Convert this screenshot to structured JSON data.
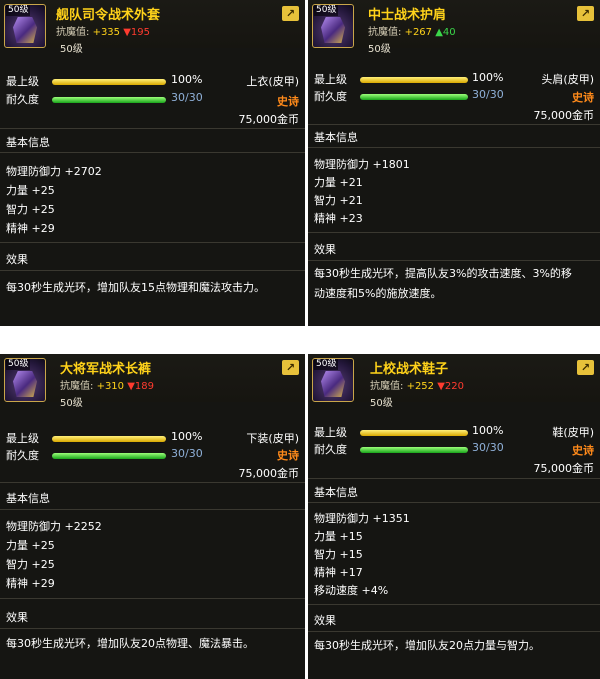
{
  "labels": {
    "max_level": "最上级",
    "durability": "耐久度",
    "resist": "抗魔值:",
    "basic_info": "基本信息",
    "effect": "效果"
  },
  "colors": {
    "rarity": "#ff8a1a",
    "name": "#ffd21a",
    "negative": "#ff3b2f",
    "positive": "#3bd64a"
  },
  "cards": [
    {
      "level_badge": "50级",
      "name": "舰队司令战术外套",
      "resist_plus": "+335",
      "resist_delta": "▼195",
      "resist_delta_type": "down",
      "level": "50级",
      "max_level_pct": "100%",
      "max_level_fraction": 1.0,
      "durability": "30/30",
      "durability_fraction": 1.0,
      "slot": "上衣(皮甲)",
      "rarity": "史诗",
      "price": "75,000金币",
      "icon": "coat-armor-icon",
      "stats": [
        "物理防御力 +2702",
        "力量 +25",
        "智力 +25",
        "精神 +29"
      ],
      "effect_lines": [
        "每30秒生成光环，增加队友15点物理和魔法攻击力。"
      ]
    },
    {
      "level_badge": "50级",
      "name": "中士战术护肩",
      "resist_plus": "+267",
      "resist_delta": "▲40",
      "resist_delta_type": "up",
      "level": "50级",
      "max_level_pct": "100%",
      "max_level_fraction": 1.0,
      "durability": "30/30",
      "durability_fraction": 1.0,
      "slot": "头肩(皮甲)",
      "rarity": "史诗",
      "price": "75,000金币",
      "icon": "shoulder-armor-icon",
      "stats": [
        "物理防御力 +1801",
        "力量 +21",
        "智力 +21",
        "精神 +23"
      ],
      "effect_lines": [
        "每30秒生成光环，提高队友3%的攻击速度、3%的移",
        "动速度和5%的施放速度。"
      ]
    },
    {
      "level_badge": "50级",
      "name": "大将军战术长裤",
      "resist_plus": "+310",
      "resist_delta": "▼189",
      "resist_delta_type": "down",
      "level": "50级",
      "max_level_pct": "100%",
      "max_level_fraction": 1.0,
      "durability": "30/30",
      "durability_fraction": 1.0,
      "slot": "下装(皮甲)",
      "rarity": "史诗",
      "price": "75,000金币",
      "icon": "pants-armor-icon",
      "stats": [
        "物理防御力 +2252",
        "力量 +25",
        "智力 +25",
        "精神 +29"
      ],
      "effect_lines": [
        "每30秒生成光环，增加队友20点物理、魔法暴击。"
      ]
    },
    {
      "level_badge": "50级",
      "name": "上校战术鞋子",
      "resist_plus": "+252",
      "resist_delta": "▼220",
      "resist_delta_type": "down",
      "level": "50级",
      "max_level_pct": "100%",
      "max_level_fraction": 1.0,
      "durability": "30/30",
      "durability_fraction": 1.0,
      "slot": "鞋(皮甲)",
      "rarity": "史诗",
      "price": "75,000金币",
      "icon": "boots-armor-icon",
      "stats": [
        "物理防御力 +1351",
        "力量 +15",
        "智力 +15",
        "精神 +17",
        "移动速度 +4%"
      ],
      "effect_lines": [
        "每30秒生成光环，增加队友20点力量与智力。"
      ]
    }
  ]
}
